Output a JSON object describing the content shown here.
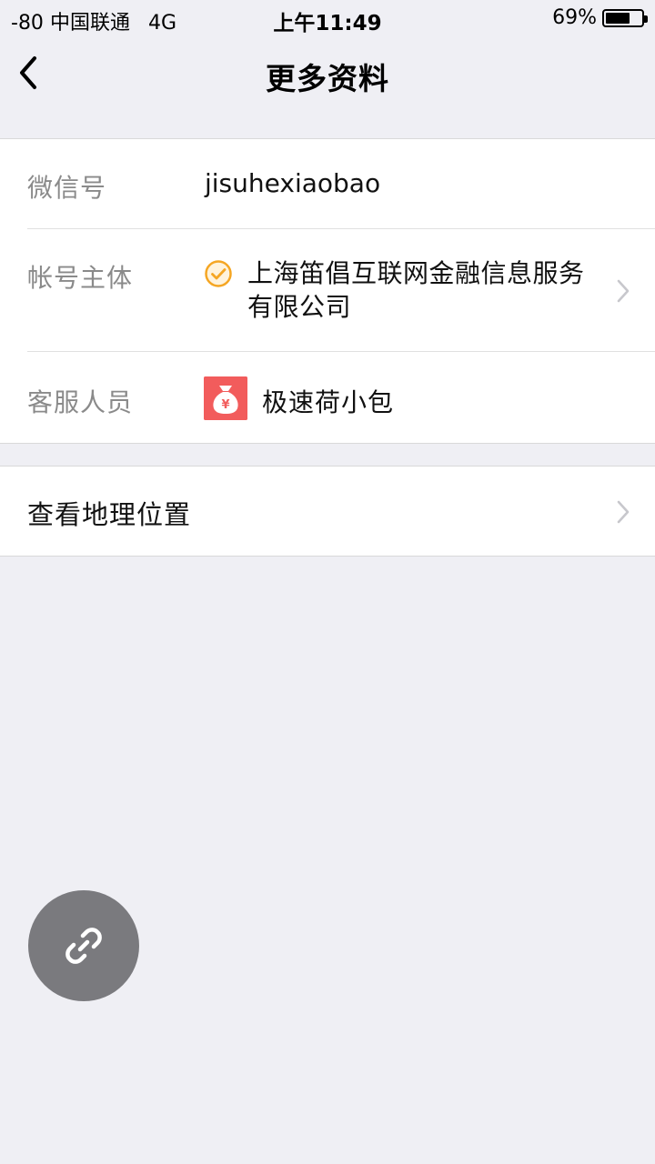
{
  "status_bar": {
    "signal": "-80",
    "carrier": "中国联通",
    "network": "4G",
    "time": "上午11:49",
    "battery_percent": "69%",
    "battery_level": 0.69
  },
  "nav": {
    "title": "更多资料",
    "back_icon": "chevron-left-icon"
  },
  "info": {
    "wechat_id_label": "微信号",
    "wechat_id_value": "jisuhexiaobao",
    "entity_label": "帐号主体",
    "entity_value": "上海笛倡互联网金融信息服务有限公司",
    "entity_icon": "verified-check-icon",
    "service_label": "客服人员",
    "service_value": "极速荷小包",
    "service_icon": "money-bag-icon"
  },
  "location": {
    "label": "查看地理位置"
  },
  "float_button": {
    "icon": "link-icon"
  },
  "colors": {
    "background": "#efeff4",
    "verified": "#f5a623",
    "avatar": "#f25c5c",
    "float_button": "#7a7a7e"
  }
}
